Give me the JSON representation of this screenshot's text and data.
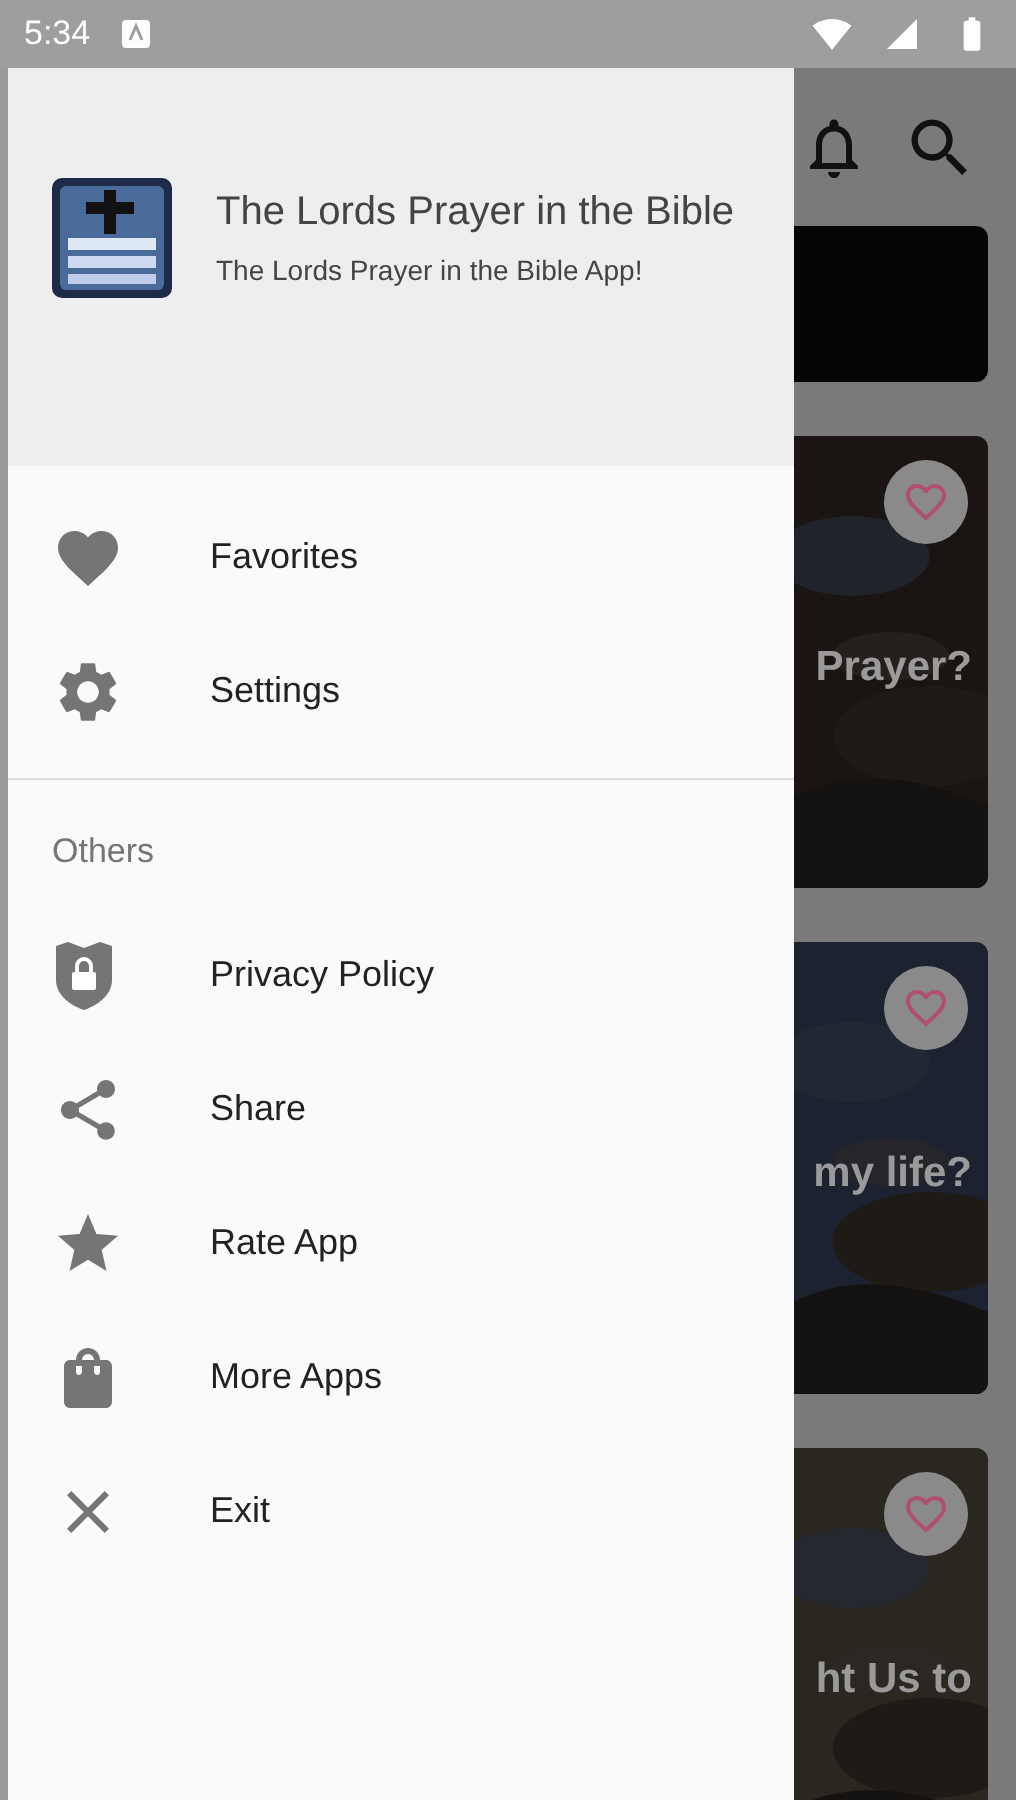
{
  "status_bar": {
    "time": "5:34"
  },
  "drawer": {
    "header": {
      "title": "The Lords Prayer in the Bible",
      "subtitle": "The Lords Prayer in the Bible App!"
    },
    "sections": [
      {
        "items": [
          {
            "kind": "heart",
            "label": "Favorites"
          },
          {
            "kind": "gear",
            "label": "Settings"
          }
        ]
      },
      {
        "title": "Others",
        "items": [
          {
            "kind": "shield",
            "label": "Privacy Policy"
          },
          {
            "kind": "share",
            "label": "Share"
          },
          {
            "kind": "star",
            "label": "Rate App"
          },
          {
            "kind": "bag",
            "label": "More Apps"
          },
          {
            "kind": "close",
            "label": "Exit"
          }
        ]
      }
    ]
  },
  "background": {
    "cards": [
      {
        "title": "Prayer?"
      },
      {
        "title": "my life?"
      },
      {
        "title": "ht Us to"
      }
    ]
  }
}
